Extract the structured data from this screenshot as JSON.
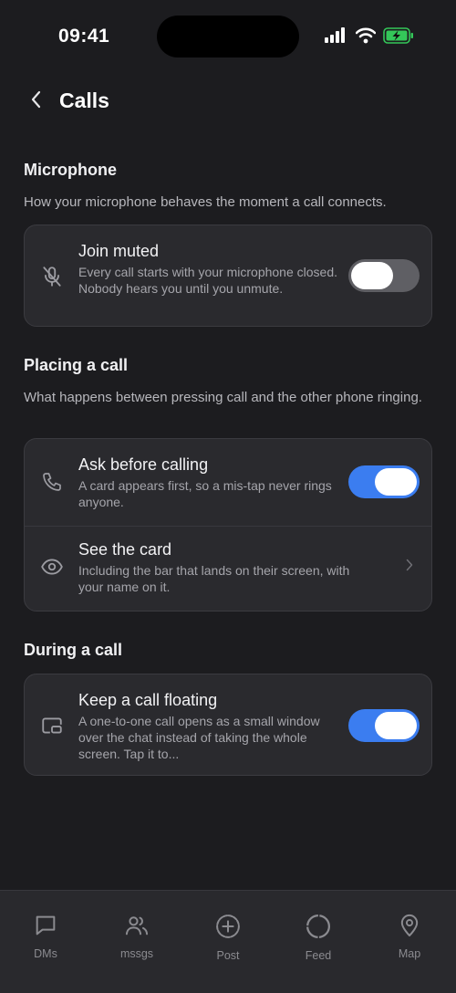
{
  "status_bar": {
    "time": "09:41",
    "icons": [
      "signal-icon",
      "wifi-icon",
      "battery-charging-icon"
    ],
    "battery_color": "#34c759"
  },
  "header": {
    "title": "Calls",
    "back_icon": "chevron-left-icon"
  },
  "sections": {
    "microphone": {
      "title": "Microphone",
      "description": "How your microphone behaves the moment a call connects.",
      "join_muted": {
        "title": "Join muted",
        "subtitle": "Every call starts with your microphone closed. Nobody hears you until you unmute.",
        "icon": "mic-off-icon",
        "enabled": false
      }
    },
    "placing": {
      "title": "Placing a call",
      "description": "What happens between pressing call and the other phone ringing.",
      "ask_before_calling": {
        "title": "Ask before calling",
        "subtitle": "A card appears first, so a mis-tap never rings anyone.",
        "icon": "phone-icon",
        "enabled": true
      },
      "see_card": {
        "title": "See the card",
        "subtitle": "Including the bar that lands on their screen, with your name on it.",
        "icon": "eye-icon"
      }
    },
    "during": {
      "title": "During a call",
      "keep_floating": {
        "title": "Keep a call floating",
        "subtitle": "A one-to-one call opens as a small window over the chat instead of taking the whole screen. Tap it to...",
        "icon": "picture-in-picture-icon",
        "enabled": true
      }
    }
  },
  "colors": {
    "accent": "#3b7df0",
    "background": "#1c1c1f",
    "card": "#2a2a2e"
  },
  "tab_bar": {
    "tabs": [
      {
        "label": "DMs",
        "icon": "chat-bubble-icon"
      },
      {
        "label": "mssgs",
        "icon": "people-icon"
      },
      {
        "label": "Post",
        "icon": "plus-circle-icon"
      },
      {
        "label": "Feed",
        "icon": "circle-icon"
      },
      {
        "label": "Map",
        "icon": "map-pin-icon"
      }
    ]
  }
}
